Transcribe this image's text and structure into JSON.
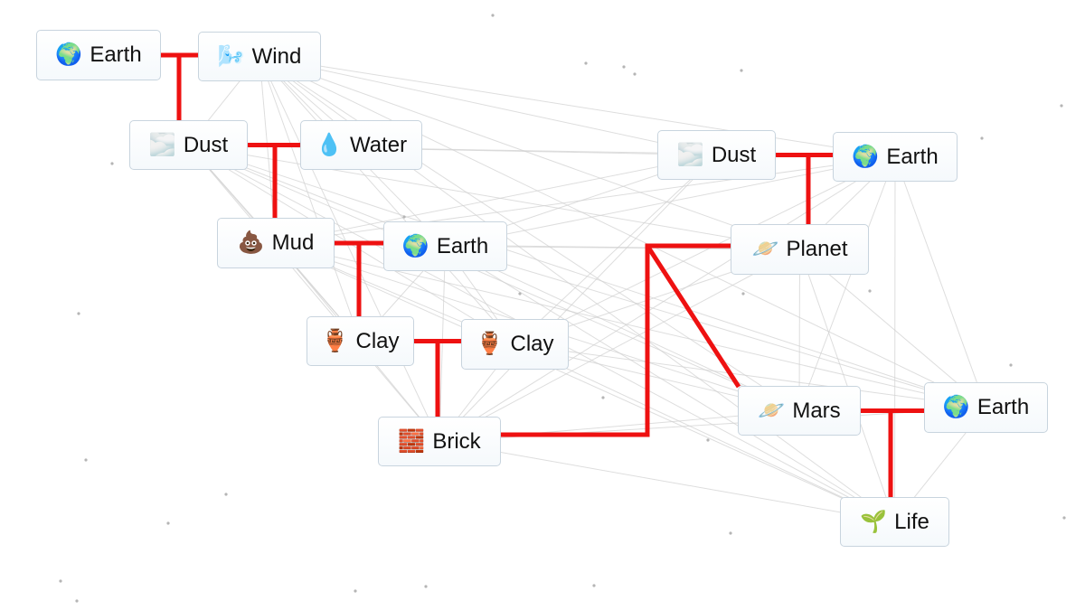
{
  "app": "Infinite Craft recipe tree",
  "target": "Life",
  "colors": {
    "link": "#ee1111",
    "mesh": "#d0d0d0",
    "dot": "#b5b5b5",
    "node_border": "#c8d4de",
    "background": "#ffffff"
  },
  "nodes": [
    {
      "id": "earth1",
      "label": "Earth",
      "icon": "earth-globe-icon",
      "emoji": "🌍"
    },
    {
      "id": "wind",
      "label": "Wind",
      "icon": "wind-icon",
      "emoji": "🌬️"
    },
    {
      "id": "dust1",
      "label": "Dust",
      "icon": "wavy-dust-icon",
      "emoji": "🌫️"
    },
    {
      "id": "water",
      "label": "Water",
      "icon": "water-drop-icon",
      "emoji": "💧"
    },
    {
      "id": "mud",
      "label": "Mud",
      "icon": "mud-icon",
      "emoji": "💩"
    },
    {
      "id": "earth2",
      "label": "Earth",
      "icon": "earth-globe-icon",
      "emoji": "🌍"
    },
    {
      "id": "clay1",
      "label": "Clay",
      "icon": "clay-jar-icon",
      "emoji": "🏺"
    },
    {
      "id": "clay2",
      "label": "Clay",
      "icon": "clay-jar-icon",
      "emoji": "🏺"
    },
    {
      "id": "brick",
      "label": "Brick",
      "icon": "brick-icon",
      "emoji": "🧱"
    },
    {
      "id": "dust2",
      "label": "Dust",
      "icon": "wavy-dust-icon",
      "emoji": "🌫️"
    },
    {
      "id": "earth3",
      "label": "Earth",
      "icon": "earth-globe-icon",
      "emoji": "🌍"
    },
    {
      "id": "planet",
      "label": "Planet",
      "icon": "planet-icon",
      "emoji": "🪐"
    },
    {
      "id": "mars",
      "label": "Mars",
      "icon": "planet-icon",
      "emoji": "🪐"
    },
    {
      "id": "earth4",
      "label": "Earth",
      "icon": "earth-globe-icon",
      "emoji": "🌍"
    },
    {
      "id": "life",
      "label": "Life",
      "icon": "seedling-icon",
      "emoji": "🌱"
    }
  ],
  "recipes": [
    {
      "inputs": [
        "earth1",
        "wind"
      ],
      "output": "dust1"
    },
    {
      "inputs": [
        "dust1",
        "water"
      ],
      "output": "mud"
    },
    {
      "inputs": [
        "mud",
        "earth2"
      ],
      "output": "clay1"
    },
    {
      "inputs": [
        "clay1",
        "clay2"
      ],
      "output": "brick"
    },
    {
      "inputs": [
        "dust2",
        "earth3"
      ],
      "output": "planet"
    },
    {
      "inputs": [
        "brick",
        "planet"
      ],
      "output": "mars"
    },
    {
      "inputs": [
        "mars",
        "earth4"
      ],
      "output": "life"
    }
  ]
}
